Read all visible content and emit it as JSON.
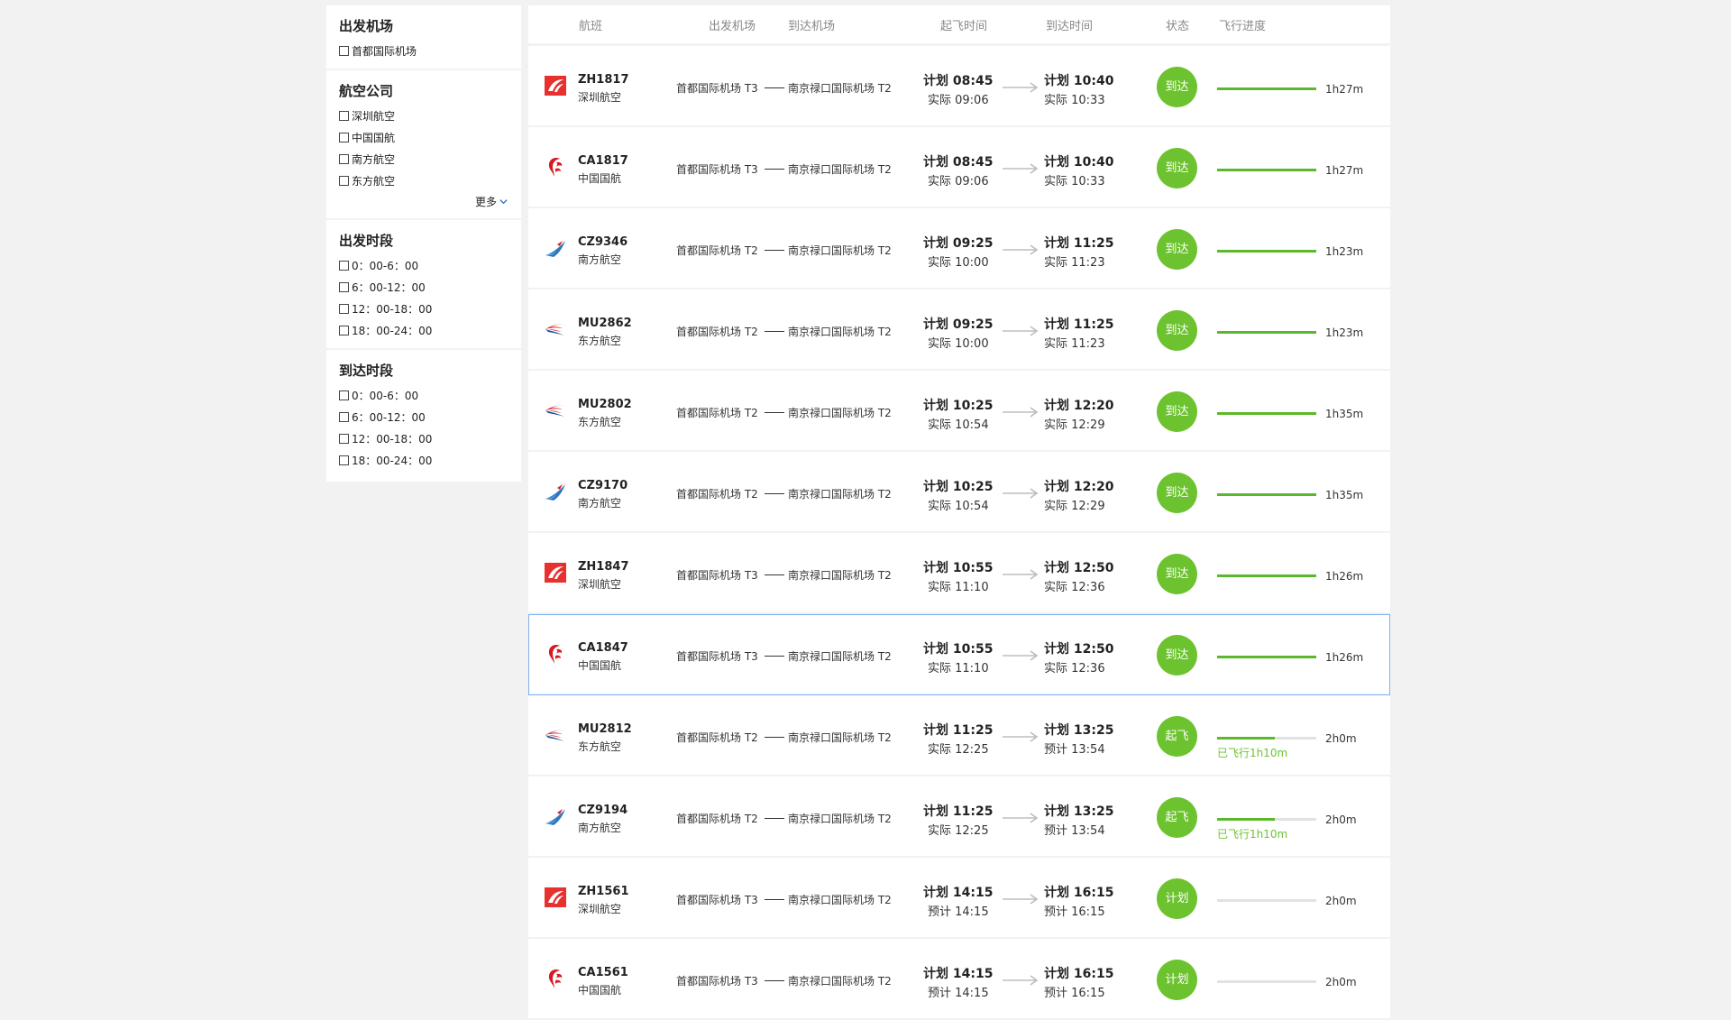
{
  "filters": {
    "departure_airport": {
      "title": "出发机场",
      "options": [
        "首都国际机场"
      ]
    },
    "airline": {
      "title": "航空公司",
      "options": [
        "深圳航空",
        "中国国航",
        "南方航空",
        "东方航空"
      ],
      "more_label": "更多"
    },
    "departure_time": {
      "title": "出发时段",
      "options": [
        "0：00-6：00",
        "6：00-12：00",
        "12：00-18：00",
        "18：00-24：00"
      ]
    },
    "arrival_time": {
      "title": "到达时段",
      "options": [
        "0：00-6：00",
        "6：00-12：00",
        "12：00-18：00",
        "18：00-24：00"
      ]
    }
  },
  "table_header": {
    "flight": "航班",
    "departure_airport": "出发机场",
    "arrival_airport": "到达机场",
    "departure_time": "起飞时间",
    "arrival_time": "到达时间",
    "status": "状态",
    "progress": "飞行进度"
  },
  "colors": {
    "status_green": "#6cc32f",
    "progress_green": "#5cb82b",
    "selected_border": "#7fb0ee",
    "shenzhen_red": "#e8302e",
    "airchina_red": "#d71920",
    "southern_blue": "#2e76bf",
    "eastern_red": "#d6232b",
    "eastern_blue": "#1c4f9c"
  },
  "flights": [
    {
      "logo": "shenzhen-airlines-logo-icon",
      "flight_no": "ZH1817",
      "airline": "深圳航空",
      "dep_airport": "首都国际机场 T3",
      "arr_airport": "南京禄口国际机场 T2",
      "dep_plan": "计划 08:45",
      "dep_actual": "实际 09:06",
      "arr_plan": "计划 10:40",
      "arr_actual": "实际 10:33",
      "status": "到达",
      "progress": 1.0,
      "duration": "1h27m",
      "flown": ""
    },
    {
      "logo": "air-china-logo-icon",
      "flight_no": "CA1817",
      "airline": "中国国航",
      "dep_airport": "首都国际机场 T3",
      "arr_airport": "南京禄口国际机场 T2",
      "dep_plan": "计划 08:45",
      "dep_actual": "实际 09:06",
      "arr_plan": "计划 10:40",
      "arr_actual": "实际 10:33",
      "status": "到达",
      "progress": 1.0,
      "duration": "1h27m",
      "flown": ""
    },
    {
      "logo": "china-southern-logo-icon",
      "flight_no": "CZ9346",
      "airline": "南方航空",
      "dep_airport": "首都国际机场 T2",
      "arr_airport": "南京禄口国际机场 T2",
      "dep_plan": "计划 09:25",
      "dep_actual": "实际 10:00",
      "arr_plan": "计划 11:25",
      "arr_actual": "实际 11:23",
      "status": "到达",
      "progress": 1.0,
      "duration": "1h23m",
      "flown": ""
    },
    {
      "logo": "china-eastern-logo-icon",
      "flight_no": "MU2862",
      "airline": "东方航空",
      "dep_airport": "首都国际机场 T2",
      "arr_airport": "南京禄口国际机场 T2",
      "dep_plan": "计划 09:25",
      "dep_actual": "实际 10:00",
      "arr_plan": "计划 11:25",
      "arr_actual": "实际 11:23",
      "status": "到达",
      "progress": 1.0,
      "duration": "1h23m",
      "flown": ""
    },
    {
      "logo": "china-eastern-logo-icon",
      "flight_no": "MU2802",
      "airline": "东方航空",
      "dep_airport": "首都国际机场 T2",
      "arr_airport": "南京禄口国际机场 T2",
      "dep_plan": "计划 10:25",
      "dep_actual": "实际 10:54",
      "arr_plan": "计划 12:20",
      "arr_actual": "实际 12:29",
      "status": "到达",
      "progress": 1.0,
      "duration": "1h35m",
      "flown": ""
    },
    {
      "logo": "china-southern-logo-icon",
      "flight_no": "CZ9170",
      "airline": "南方航空",
      "dep_airport": "首都国际机场 T2",
      "arr_airport": "南京禄口国际机场 T2",
      "dep_plan": "计划 10:25",
      "dep_actual": "实际 10:54",
      "arr_plan": "计划 12:20",
      "arr_actual": "实际 12:29",
      "status": "到达",
      "progress": 1.0,
      "duration": "1h35m",
      "flown": ""
    },
    {
      "logo": "shenzhen-airlines-logo-icon",
      "flight_no": "ZH1847",
      "airline": "深圳航空",
      "dep_airport": "首都国际机场 T3",
      "arr_airport": "南京禄口国际机场 T2",
      "dep_plan": "计划 10:55",
      "dep_actual": "实际 11:10",
      "arr_plan": "计划 12:50",
      "arr_actual": "实际 12:36",
      "status": "到达",
      "progress": 1.0,
      "duration": "1h26m",
      "flown": ""
    },
    {
      "logo": "air-china-logo-icon",
      "flight_no": "CA1847",
      "airline": "中国国航",
      "dep_airport": "首都国际机场 T3",
      "arr_airport": "南京禄口国际机场 T2",
      "dep_plan": "计划 10:55",
      "dep_actual": "实际 11:10",
      "arr_plan": "计划 12:50",
      "arr_actual": "实际 12:36",
      "status": "到达",
      "progress": 1.0,
      "duration": "1h26m",
      "flown": "",
      "selected": true
    },
    {
      "logo": "china-eastern-logo-icon",
      "flight_no": "MU2812",
      "airline": "东方航空",
      "dep_airport": "首都国际机场 T2",
      "arr_airport": "南京禄口国际机场 T2",
      "dep_plan": "计划 11:25",
      "dep_actual": "实际 12:25",
      "arr_plan": "计划 13:25",
      "arr_actual": "预计 13:54",
      "status": "起飞",
      "progress": 0.58,
      "duration": "2h0m",
      "flown": "已飞行1h10m"
    },
    {
      "logo": "china-southern-logo-icon",
      "flight_no": "CZ9194",
      "airline": "南方航空",
      "dep_airport": "首都国际机场 T2",
      "arr_airport": "南京禄口国际机场 T2",
      "dep_plan": "计划 11:25",
      "dep_actual": "实际 12:25",
      "arr_plan": "计划 13:25",
      "arr_actual": "预计 13:54",
      "status": "起飞",
      "progress": 0.58,
      "duration": "2h0m",
      "flown": "已飞行1h10m"
    },
    {
      "logo": "shenzhen-airlines-logo-icon",
      "flight_no": "ZH1561",
      "airline": "深圳航空",
      "dep_airport": "首都国际机场 T3",
      "arr_airport": "南京禄口国际机场 T2",
      "dep_plan": "计划 14:15",
      "dep_actual": "预计 14:15",
      "arr_plan": "计划 16:15",
      "arr_actual": "预计 16:15",
      "status": "计划",
      "progress": 0.0,
      "duration": "2h0m",
      "flown": ""
    },
    {
      "logo": "air-china-logo-icon",
      "flight_no": "CA1561",
      "airline": "中国国航",
      "dep_airport": "首都国际机场 T3",
      "arr_airport": "南京禄口国际机场 T2",
      "dep_plan": "计划 14:15",
      "dep_actual": "预计 14:15",
      "arr_plan": "计划 16:15",
      "arr_actual": "预计 16:15",
      "status": "计划",
      "progress": 0.0,
      "duration": "2h0m",
      "flown": ""
    }
  ]
}
